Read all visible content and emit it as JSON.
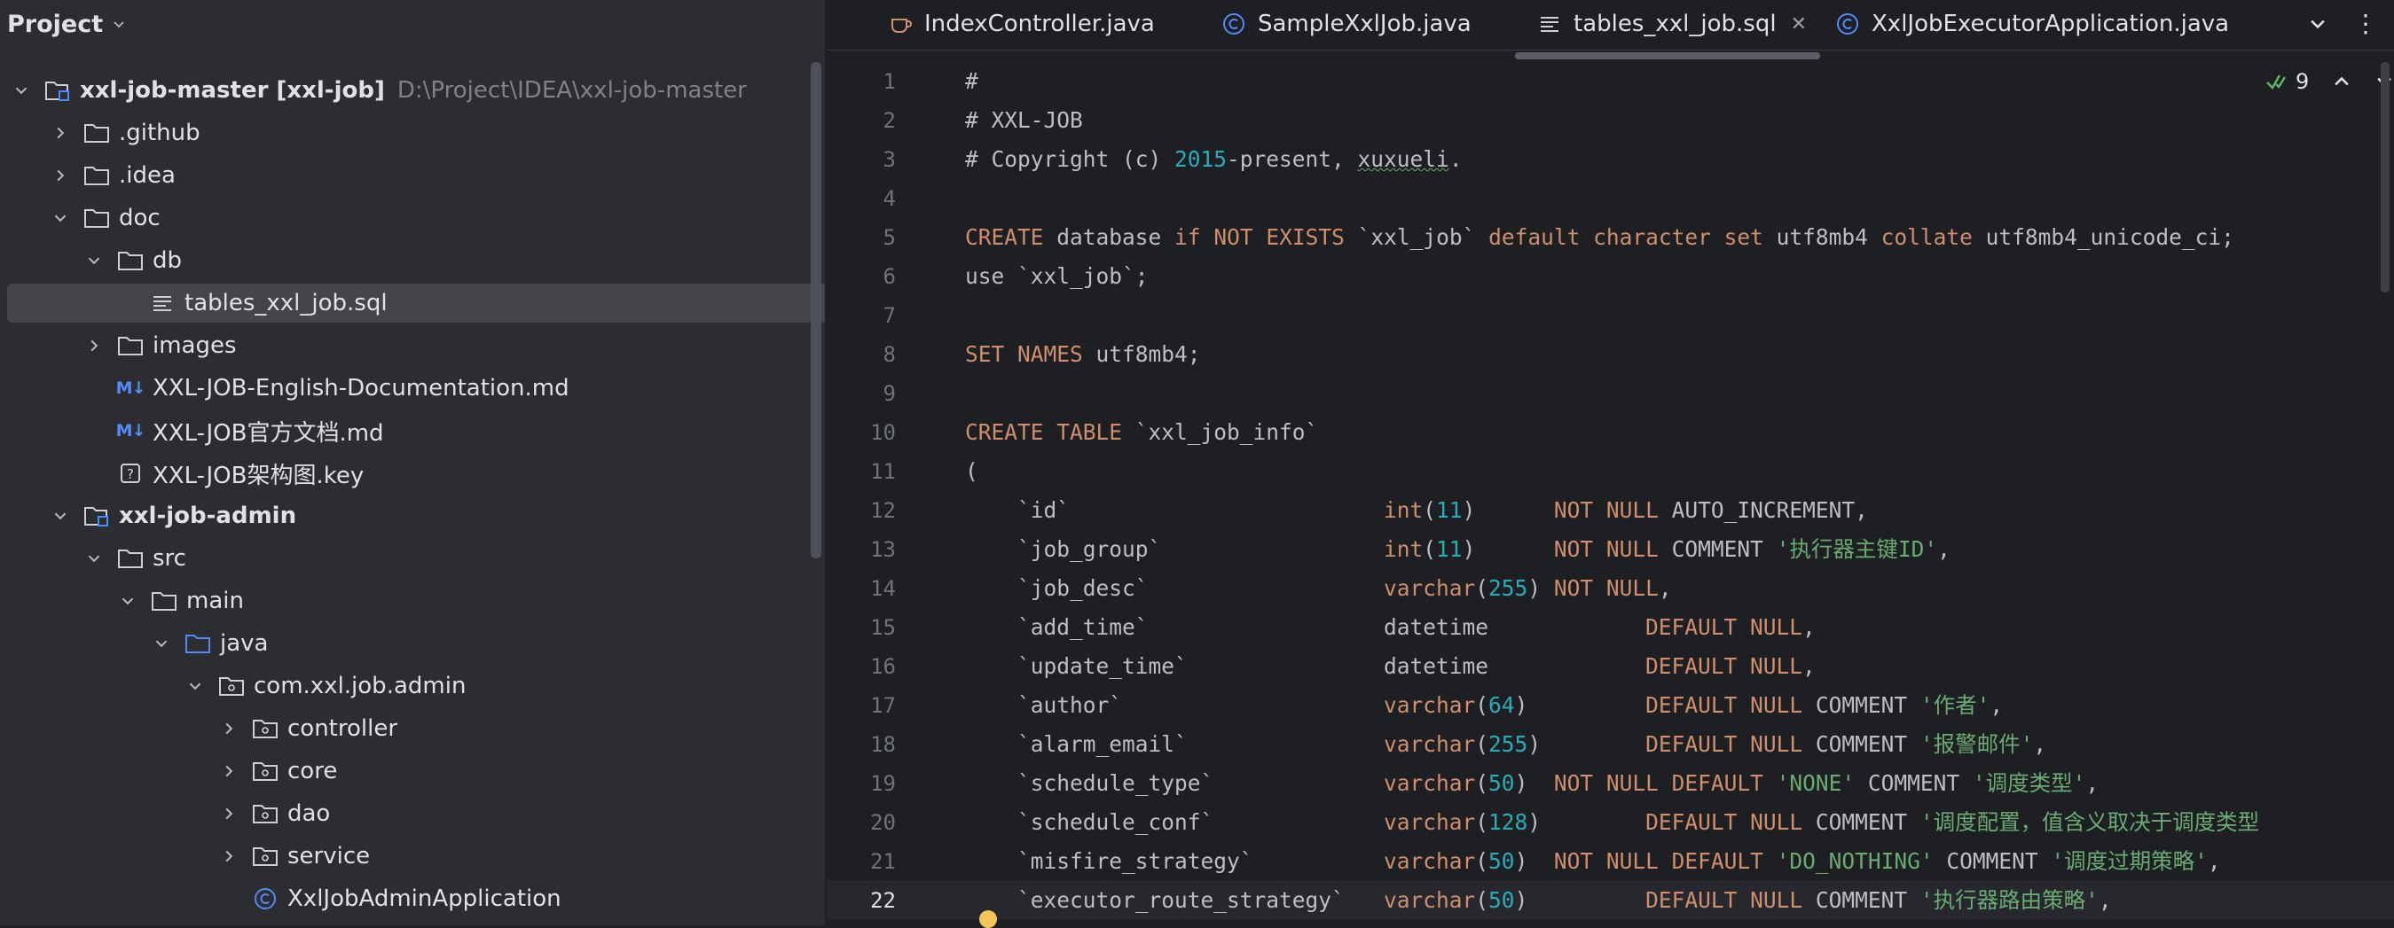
{
  "project_panel": {
    "title": "Project",
    "tree": [
      {
        "label": "xxl-job-master [xxl-job]",
        "hint": "D:\\Project\\IDEA\\xxl-job-master",
        "icon": "module-folder-icon"
      },
      {
        "label": ".github",
        "icon": "folder-icon"
      },
      {
        "label": ".idea",
        "icon": "folder-icon"
      },
      {
        "label": "doc",
        "icon": "folder-icon"
      },
      {
        "label": "db",
        "icon": "folder-icon"
      },
      {
        "label": "tables_xxl_job.sql",
        "icon": "sql-file-icon"
      },
      {
        "label": "images",
        "icon": "folder-icon"
      },
      {
        "label": "XXL-JOB-English-Documentation.md",
        "icon": "markdown-icon",
        "badge": "M↓"
      },
      {
        "label": "XXL-JOB官方文档.md",
        "icon": "markdown-icon",
        "badge": "M↓"
      },
      {
        "label": "XXL-JOB架构图.key",
        "icon": "unknown-file-icon"
      },
      {
        "label": "xxl-job-admin",
        "icon": "module-folder-icon"
      },
      {
        "label": "src",
        "icon": "folder-icon"
      },
      {
        "label": "main",
        "icon": "folder-icon"
      },
      {
        "label": "java",
        "icon": "source-folder-icon"
      },
      {
        "label": "com.xxl.job.admin",
        "icon": "package-icon"
      },
      {
        "label": "controller",
        "icon": "package-icon"
      },
      {
        "label": "core",
        "icon": "package-icon"
      },
      {
        "label": "dao",
        "icon": "package-icon"
      },
      {
        "label": "service",
        "icon": "package-icon"
      },
      {
        "label": "XxlJobAdminApplication",
        "icon": "java-class-icon"
      }
    ]
  },
  "tabs": [
    {
      "label": "IndexController.java",
      "icon": "java-file-icon"
    },
    {
      "label": "SampleXxlJob.java",
      "icon": "java-class-icon"
    },
    {
      "label": "tables_xxl_job.sql",
      "icon": "sql-file-icon",
      "active": true
    },
    {
      "label": "XxlJobExecutorApplication.java",
      "icon": "java-class-icon"
    }
  ],
  "editor": {
    "inspection_count": "9",
    "current_line": "22",
    "line_numbers": [
      "1",
      "2",
      "3",
      "4",
      "5",
      "6",
      "7",
      "8",
      "9",
      "10",
      "11",
      "12",
      "13",
      "14",
      "15",
      "16",
      "17",
      "18",
      "19",
      "20",
      "21",
      "22"
    ],
    "lines": [
      [
        {
          "t": "#"
        }
      ],
      [
        {
          "t": "# XXL-JOB"
        }
      ],
      [
        {
          "t": "# Copyright (c) "
        },
        {
          "t": "2015",
          "c": "num"
        },
        {
          "t": "-present, "
        },
        {
          "t": "xuxueli",
          "c": "ul"
        },
        {
          "t": "."
        }
      ],
      [],
      [
        {
          "t": "CREATE",
          "c": "kw"
        },
        {
          "t": " database "
        },
        {
          "t": "if",
          "c": "kw"
        },
        {
          "t": " "
        },
        {
          "t": "NOT EXISTS",
          "c": "kw"
        },
        {
          "t": " `xxl_job` "
        },
        {
          "t": "default character set",
          "c": "kw"
        },
        {
          "t": " utf8mb4 "
        },
        {
          "t": "collate",
          "c": "kw"
        },
        {
          "t": " utf8mb4_unicode_ci;"
        }
      ],
      [
        {
          "t": "use `xxl_job`;"
        }
      ],
      [],
      [
        {
          "t": "SET NAMES",
          "c": "kw"
        },
        {
          "t": " utf8mb4;"
        }
      ],
      [],
      [
        {
          "t": "CREATE TABLE",
          "c": "kw"
        },
        {
          "t": " `xxl_job_info`"
        }
      ],
      [
        {
          "t": "("
        }
      ],
      [
        {
          "t": "    `id`                        "
        },
        {
          "t": "int",
          "c": "kw"
        },
        {
          "t": "("
        },
        {
          "t": "11",
          "c": "num"
        },
        {
          "t": ")      "
        },
        {
          "t": "NOT NULL",
          "c": "kw"
        },
        {
          "t": " AUTO_INCREMENT,"
        }
      ],
      [
        {
          "t": "    `job_group`                 "
        },
        {
          "t": "int",
          "c": "kw"
        },
        {
          "t": "("
        },
        {
          "t": "11",
          "c": "num"
        },
        {
          "t": ")      "
        },
        {
          "t": "NOT NULL",
          "c": "kw"
        },
        {
          "t": " COMMENT "
        },
        {
          "t": "'执行器主键ID'",
          "c": "str"
        },
        {
          "t": ","
        }
      ],
      [
        {
          "t": "    `job_desc`                  "
        },
        {
          "t": "varchar",
          "c": "kw"
        },
        {
          "t": "("
        },
        {
          "t": "255",
          "c": "num"
        },
        {
          "t": ") "
        },
        {
          "t": "NOT NULL",
          "c": "kw"
        },
        {
          "t": ","
        }
      ],
      [
        {
          "t": "    `add_time`                  datetime            "
        },
        {
          "t": "DEFAULT NULL",
          "c": "kw"
        },
        {
          "t": ","
        }
      ],
      [
        {
          "t": "    `update_time`               datetime            "
        },
        {
          "t": "DEFAULT NULL",
          "c": "kw"
        },
        {
          "t": ","
        }
      ],
      [
        {
          "t": "    `author`                    "
        },
        {
          "t": "varchar",
          "c": "kw"
        },
        {
          "t": "("
        },
        {
          "t": "64",
          "c": "num"
        },
        {
          "t": ")         "
        },
        {
          "t": "DEFAULT NULL",
          "c": "kw"
        },
        {
          "t": " COMMENT "
        },
        {
          "t": "'作者'",
          "c": "str"
        },
        {
          "t": ","
        }
      ],
      [
        {
          "t": "    `alarm_email`               "
        },
        {
          "t": "varchar",
          "c": "kw"
        },
        {
          "t": "("
        },
        {
          "t": "255",
          "c": "num"
        },
        {
          "t": ")        "
        },
        {
          "t": "DEFAULT NULL",
          "c": "kw"
        },
        {
          "t": " COMMENT "
        },
        {
          "t": "'报警邮件'",
          "c": "str"
        },
        {
          "t": ","
        }
      ],
      [
        {
          "t": "    `schedule_type`             "
        },
        {
          "t": "varchar",
          "c": "kw"
        },
        {
          "t": "("
        },
        {
          "t": "50",
          "c": "num"
        },
        {
          "t": ")  "
        },
        {
          "t": "NOT NULL DEFAULT",
          "c": "kw"
        },
        {
          "t": " "
        },
        {
          "t": "'NONE'",
          "c": "str"
        },
        {
          "t": " COMMENT "
        },
        {
          "t": "'调度类型'",
          "c": "str"
        },
        {
          "t": ","
        }
      ],
      [
        {
          "t": "    `schedule_conf`             "
        },
        {
          "t": "varchar",
          "c": "kw"
        },
        {
          "t": "("
        },
        {
          "t": "128",
          "c": "num"
        },
        {
          "t": ")        "
        },
        {
          "t": "DEFAULT NULL",
          "c": "kw"
        },
        {
          "t": " COMMENT "
        },
        {
          "t": "'调度配置，值含义取决于调度类型",
          "c": "str"
        }
      ],
      [
        {
          "t": "    `misfire_strategy`          "
        },
        {
          "t": "varchar",
          "c": "kw"
        },
        {
          "t": "("
        },
        {
          "t": "50",
          "c": "num"
        },
        {
          "t": ")  "
        },
        {
          "t": "NOT NULL DEFAULT",
          "c": "kw"
        },
        {
          "t": " "
        },
        {
          "t": "'DO_NOTHING'",
          "c": "str"
        },
        {
          "t": " COMMENT "
        },
        {
          "t": "'调度过期策略'",
          "c": "str"
        },
        {
          "t": ","
        }
      ],
      [
        {
          "t": "    `executor_route_strategy`   "
        },
        {
          "t": "varchar",
          "c": "kw"
        },
        {
          "t": "("
        },
        {
          "t": "50",
          "c": "num"
        },
        {
          "t": ")         "
        },
        {
          "t": "DEFAULT NULL",
          "c": "kw"
        },
        {
          "t": " COMMENT "
        },
        {
          "t": "'执行器路由策略'",
          "c": "str"
        },
        {
          "t": ","
        }
      ]
    ]
  },
  "colors": {
    "panel_bg": "#2b2d30",
    "editor_bg": "#1e1f22",
    "keyword": "#cf8e6d",
    "number": "#2aacb8",
    "string": "#6aab73",
    "selection": "#43454a"
  }
}
